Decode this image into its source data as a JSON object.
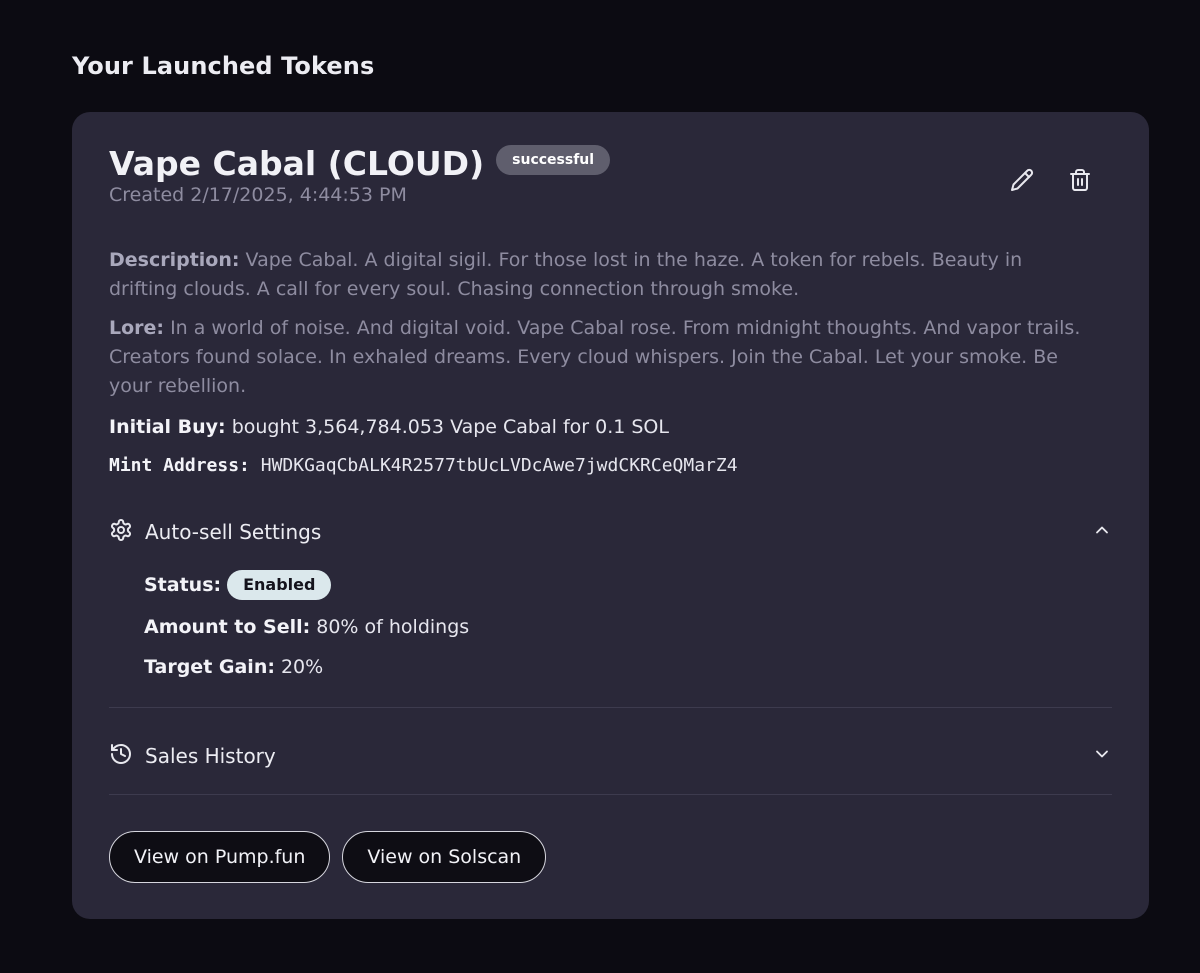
{
  "section": {
    "title": "Your Launched Tokens"
  },
  "token": {
    "name": "Vape Cabal (CLOUD)",
    "status": "successful",
    "created": "Created 2/17/2025, 4:44:53 PM",
    "description_label": "Description:",
    "description": "Vape Cabal. A digital sigil. For those lost in the haze. A token for rebels. Beauty in drifting clouds. A call for every soul. Chasing connection through smoke.",
    "lore_label": "Lore:",
    "lore": "In a world of noise. And digital void. Vape Cabal rose. From midnight thoughts. And vapor trails. Creators found solace. In exhaled dreams. Every cloud whispers. Join the Cabal. Let your smoke. Be your rebellion.",
    "initial_buy_label": "Initial Buy:",
    "initial_buy": "bought 3,564,784.053 Vape Cabal for 0.1 SOL",
    "mint_label": "Mint Address:",
    "mint_address": "HWDKGaqCbALK4R2577tbUcLVDcAwe7jwdCKRCeQMarZ4"
  },
  "icons": {
    "edit": "pencil-icon",
    "delete": "trash-icon",
    "settings": "gear-icon",
    "history": "history-icon",
    "expanded": "chevron-up-icon",
    "collapsed": "chevron-down-icon"
  },
  "autosell": {
    "header": "Auto-sell Settings",
    "status_label": "Status:",
    "status_value": "Enabled",
    "amount_label": "Amount to Sell:",
    "amount_value": "80% of holdings",
    "gain_label": "Target Gain:",
    "gain_value": "20%"
  },
  "sales_history": {
    "header": "Sales History"
  },
  "buttons": {
    "pumpfun": "View on Pump.fun",
    "solscan": "View on Solscan"
  },
  "colors": {
    "background": "#0c0b12",
    "card": "#2a2839",
    "muted_text": "#8e8ca0",
    "status_pill": "#5f5e6d",
    "enabled_pill": "#dbe8ec"
  }
}
